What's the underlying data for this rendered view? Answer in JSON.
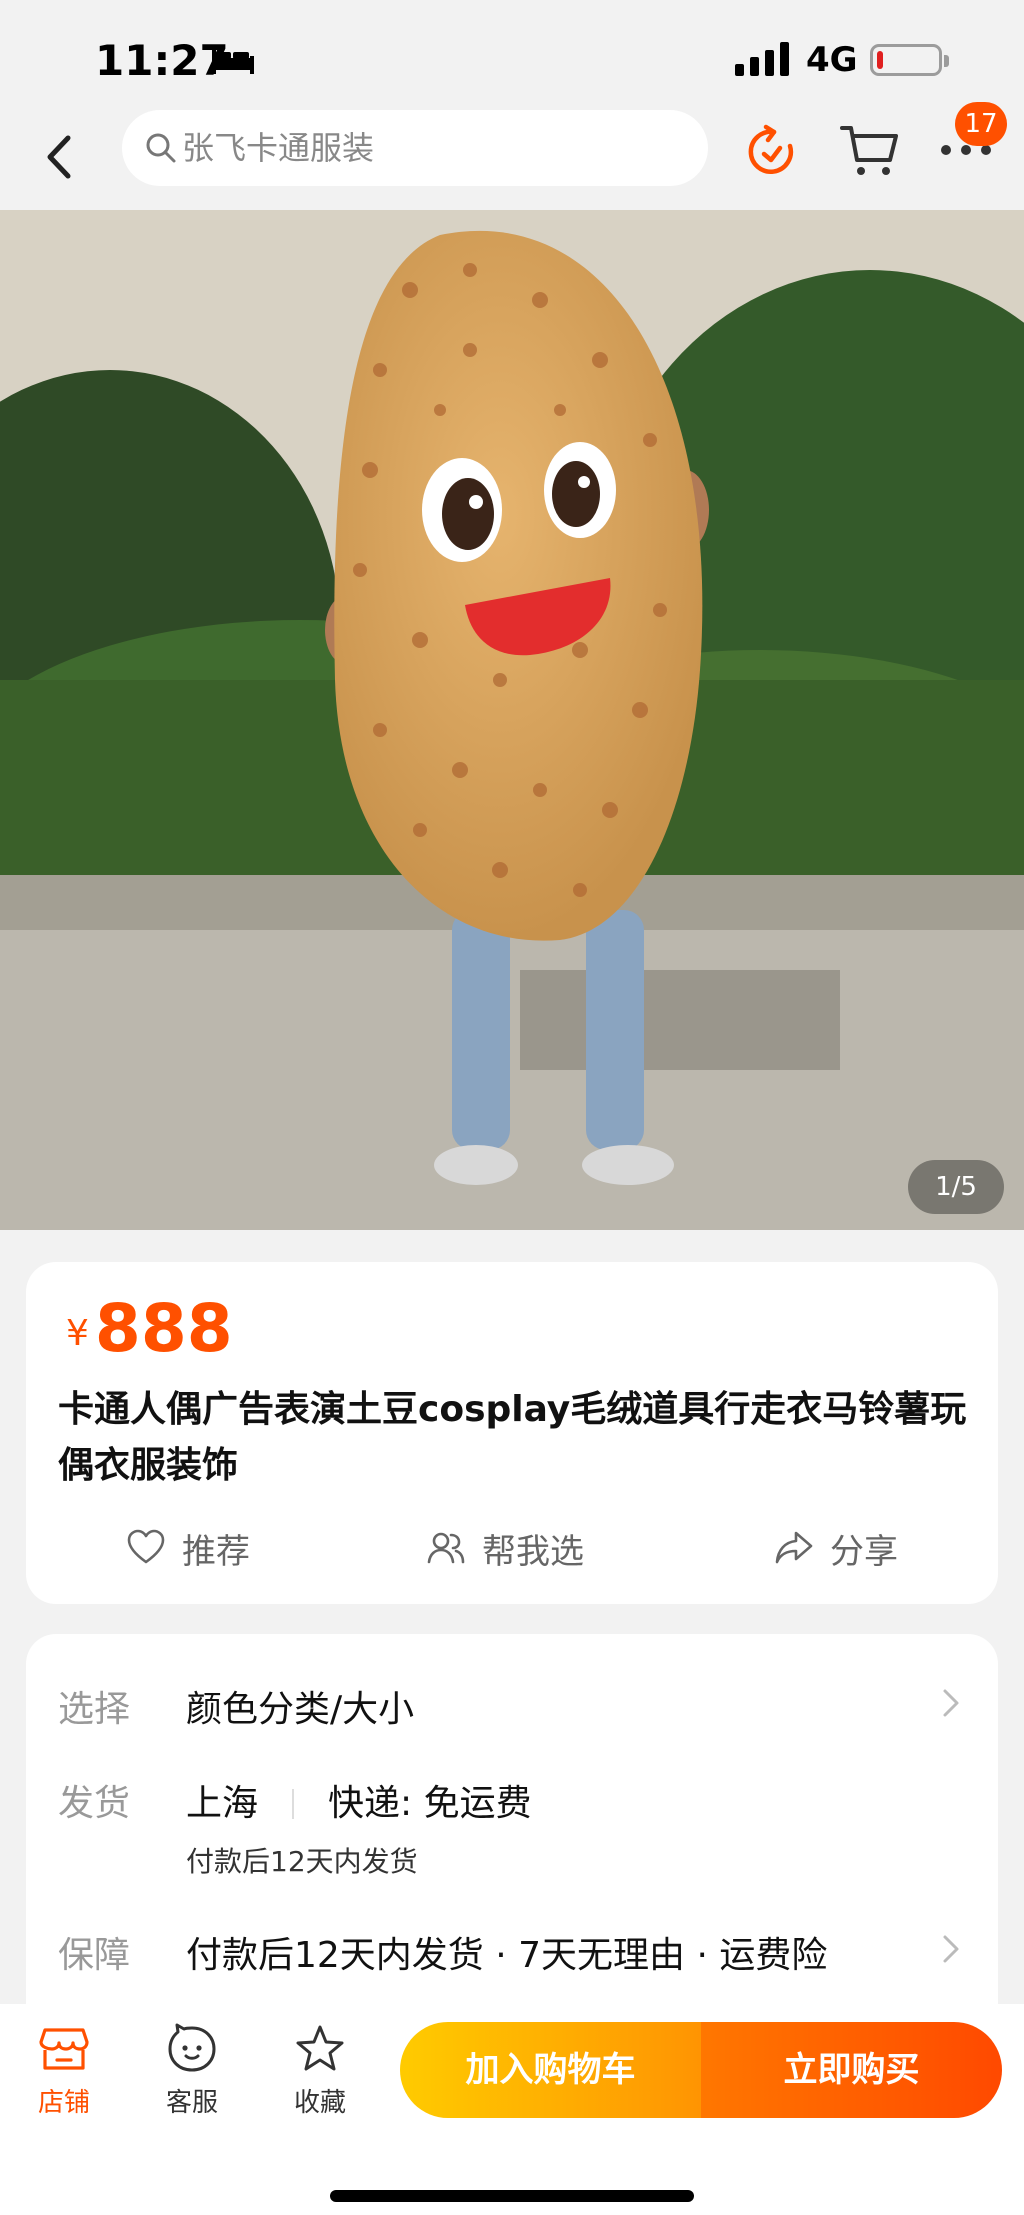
{
  "status_bar": {
    "time": "11:27",
    "network": "4G",
    "sleep_icon": "bed-icon",
    "battery_level": 0.1
  },
  "nav": {
    "search_placeholder": "张飞卡通服装",
    "more_badge": "17",
    "icons": [
      "back-arrow-icon",
      "search-icon",
      "refresh-icon",
      "cart-icon",
      "more-dots-icon"
    ]
  },
  "gallery": {
    "pager": "1/5",
    "image_subject": "potato-costume-photo"
  },
  "product": {
    "currency": "¥",
    "price": "888",
    "title": "卡通人偶广告表演土豆cosplay毛绒道具行走衣马铃薯玩偶衣服装饰",
    "actions": [
      {
        "label": "推荐",
        "icon": "heart-icon"
      },
      {
        "label": "帮我选",
        "icon": "people-icon"
      },
      {
        "label": "分享",
        "icon": "share-icon"
      }
    ]
  },
  "details": {
    "select": {
      "key": "选择",
      "value": "颜色分类/大小"
    },
    "shipping": {
      "key": "发货",
      "origin": "上海",
      "method": "快递: 免运费",
      "note": "付款后12天内发货"
    },
    "guarantee": {
      "key": "保障",
      "value": "付款后12天内发货 · 7天无理由 · 运费险"
    }
  },
  "bottom_bar": {
    "tabs": [
      {
        "label": "店铺",
        "icon": "store-icon"
      },
      {
        "label": "客服",
        "icon": "customer-service-icon"
      },
      {
        "label": "收藏",
        "icon": "star-icon"
      }
    ],
    "add_to_cart": "加入购物车",
    "buy_now": "立即购买"
  },
  "colors": {
    "accent": "#ff5000",
    "cart_button": "#ffb400",
    "buy_button": "#ff5a00"
  }
}
